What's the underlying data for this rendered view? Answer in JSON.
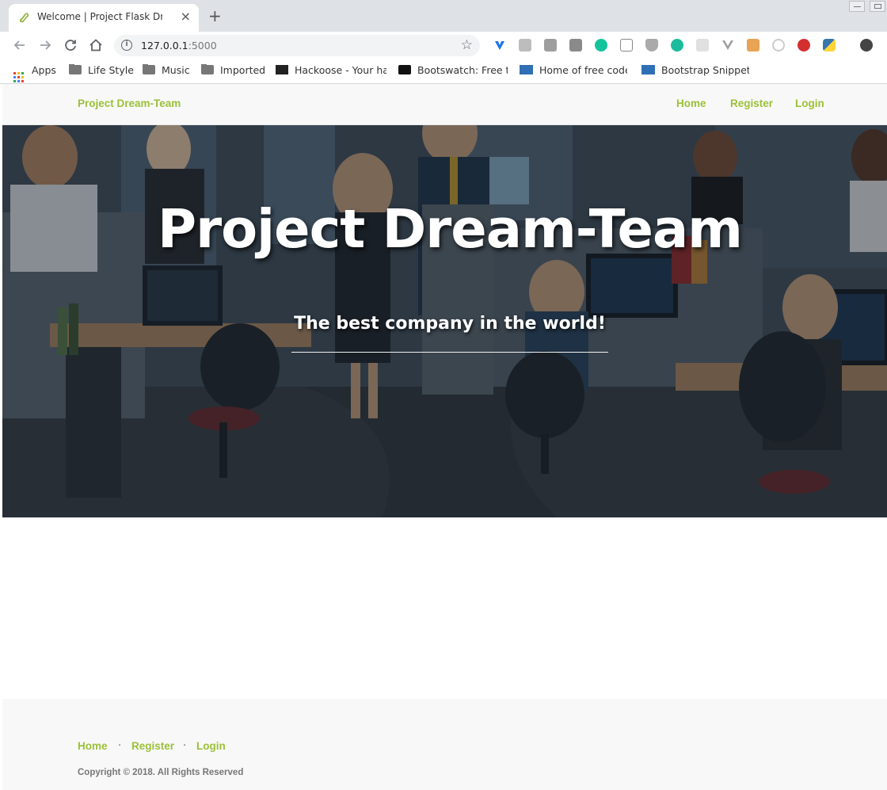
{
  "browser": {
    "tab_title": "Welcome | Project Flask Drear",
    "tab_close": "×",
    "new_tab": "+",
    "url_host": "127.0.0.1",
    "url_port": ":5000",
    "extensions": [
      "vimium-icon",
      "ext-gray-icon",
      "ext-h-icon",
      "ext-s-icon",
      "grammarly-icon",
      "ext-t-icon",
      "shield-icon",
      "mercury-icon",
      "ext-grid-icon",
      "vue-devtools-icon",
      "ext-box-icon",
      "ext-circle-icon",
      "adblock-plus-icon",
      "python-icon",
      "profile-avatar-icon"
    ],
    "bookmarks": [
      {
        "label": "Apps",
        "icon": "apps-grid-icon"
      },
      {
        "label": "Life Style",
        "icon": "folder-icon"
      },
      {
        "label": "Music",
        "icon": "folder-icon"
      },
      {
        "label": "Imported",
        "icon": "folder-icon"
      },
      {
        "label": "Hackoose - Your ha",
        "icon": "hackoose-icon"
      },
      {
        "label": "Bootswatch: Free t",
        "icon": "bootswatch-icon"
      },
      {
        "label": "Home of free code",
        "icon": "bootstrap-icon"
      },
      {
        "label": "Bootstrap Snippet",
        "icon": "bootstrap-icon"
      }
    ]
  },
  "navbar": {
    "brand": "Project Dream-Team",
    "links": [
      "Home",
      "Register",
      "Login"
    ]
  },
  "hero": {
    "title": "Project Dream-Team",
    "subtitle": "The best company in the world!"
  },
  "footer": {
    "links": [
      "Home",
      "Register",
      "Login"
    ],
    "separator": "·",
    "copyright": "Copyright © 2018. All Rights Reserved"
  },
  "colors": {
    "accent": "#9cc039",
    "navbar_bg": "#f8f8f8",
    "hero_overlay": "#2f3a44"
  }
}
